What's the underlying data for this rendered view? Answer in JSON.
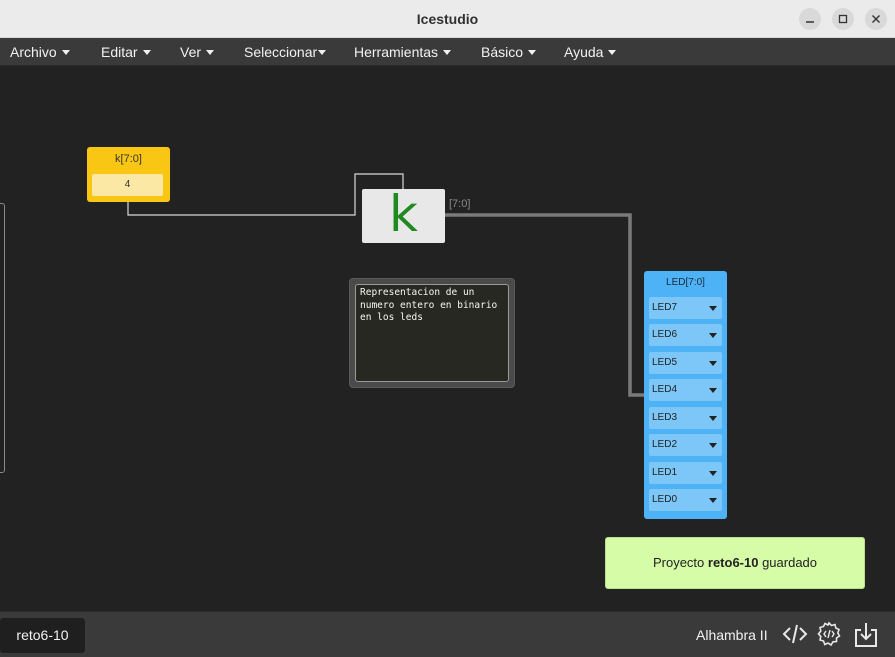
{
  "window": {
    "title": "Icestudio"
  },
  "menu": [
    {
      "label": "Archivo"
    },
    {
      "label": "Editar"
    },
    {
      "label": "Ver"
    },
    {
      "label": "Seleccionar"
    },
    {
      "label": "Herramientas"
    },
    {
      "label": "Básico"
    },
    {
      "label": "Ayuda"
    }
  ],
  "canvas": {
    "input_block": {
      "name": "k[7:0]",
      "value": "4"
    },
    "constant_block": {
      "symbol": "k"
    },
    "bus_label": "[7:0]",
    "comment": "Representacion de un\nnumero entero en binario\nen los leds",
    "output_block": {
      "name": "LED[7:0]",
      "pins": [
        "LED7",
        "LED6",
        "LED5",
        "LED4",
        "LED3",
        "LED2",
        "LED1",
        "LED0"
      ]
    }
  },
  "toast": {
    "prefix": "Proyecto ",
    "project": "reto6-10",
    "suffix": " guardado"
  },
  "footer": {
    "project_tab": "reto6-10",
    "board": "Alhambra II",
    "icons": [
      "code-icon",
      "settings-code-icon",
      "download-icon"
    ]
  },
  "colors": {
    "input_block": "#f9c613",
    "output_block": "#4eb2f7",
    "constant_glyph": "#1f8a22",
    "toast": "#d7fca8"
  }
}
